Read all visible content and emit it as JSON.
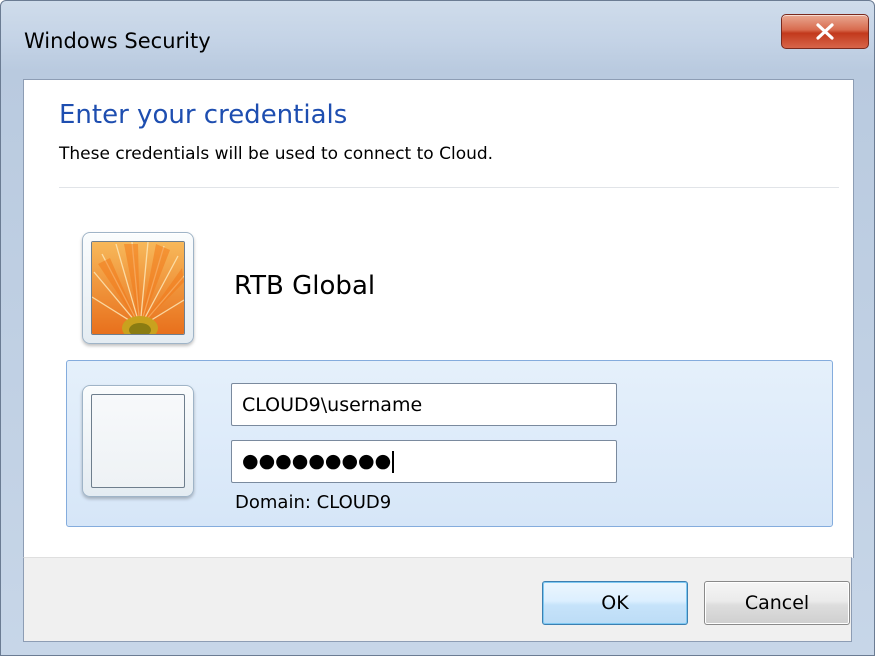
{
  "window": {
    "title": "Windows Security",
    "close_icon": "close-icon"
  },
  "dialog": {
    "heading": "Enter your credentials",
    "subtitle": "These credentials will be used to connect to Cloud."
  },
  "saved_account": {
    "name": "RTB Global",
    "avatar_icon": "flower-avatar-icon"
  },
  "new_credential": {
    "avatar_icon": "blank-avatar-icon",
    "username_value": "CLOUD9\\username",
    "password_mask": "●●●●●●●●●",
    "domain_label": "Domain: CLOUD9"
  },
  "buttons": {
    "ok_label": "OK",
    "cancel_label": "Cancel"
  },
  "colors": {
    "heading": "#1e4eb0",
    "selected_panel": "#dae8f8",
    "close_button": "#c7472a"
  }
}
